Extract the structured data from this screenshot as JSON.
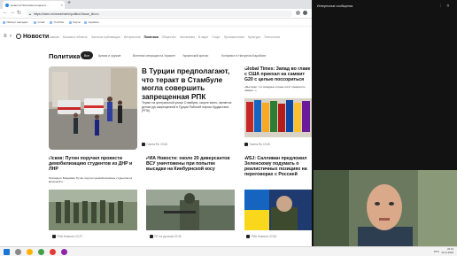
{
  "browser": {
    "tabs": [
      {
        "title": "Новости Политика сегодня в ..."
      },
      {
        "title": ""
      }
    ],
    "new_tab": "+",
    "address": "https://dzen.ru/news/rubric/politics?issue_tld=ru",
    "bookmarks": [
      "Импорт закладок",
      "Gmail",
      "YouTube",
      "Карты",
      "Сервисы"
    ]
  },
  "site": {
    "brand": "Новости",
    "nav": [
      "Главная",
      "Москва и область",
      "Частные публикации",
      "Интересное",
      "Политика",
      "Общество",
      "Экономика",
      "В мире",
      "Спорт",
      "Происшествия",
      "Культура",
      "Технологии"
    ],
    "active_nav": "Политика",
    "section_title": "Политика",
    "pills": [
      "Все",
      "Армия и оружие",
      "Военная операция на Украине",
      "Украинский кризис",
      "Конфликт в Нагорном Карабахе"
    ],
    "active_pill": "Все"
  },
  "cards": {
    "main": {
      "headline": "В Турции предполагают, что теракт в Стамбуле могла совершить запрещенная РПК",
      "lead": "Теракт на центральной улице Стамбула, скорее всего, является делом рук запрещенной в Турции Рабочей партии Курдистана (РПК).",
      "source": "Газета.Ru",
      "time": "19:46"
    },
    "global": {
      "headline": "Global Times: Запад во главе с США приехал на саммит G20 с целью поссориться",
      "lead": "«Выглядит, что западные страны хотят превратить саммит...»",
      "source": "Газета.Ru",
      "time": "19:45"
    },
    "pskov": {
      "headline": "Псков: Путин поручил провести демобилизацию студентов из ДНР и ЛНР",
      "lead": "Президент Владимир Путин поручил демобилизовать студентов из Донецкой и...",
      "source": "РИА Новости",
      "time": "22:27"
    },
    "ria": {
      "headline": "РИА Новости: около 20 диверсантов ВСУ уничтожены при попытке высадки на Кинбурнской косу",
      "source": "RT на русском",
      "time": "22:30"
    },
    "wsj": {
      "headline": "WSJ: Салливан предложил Зеленскому подумать о реалистичных позициях на переговорах с Россией",
      "source": "РИА Новости",
      "time": "22:53"
    }
  },
  "side_panel": {
    "title": "Интересные сообщения",
    "menu": "⋮",
    "close": "✕"
  },
  "taskbar": {
    "lang": "РУС",
    "time": "22:31",
    "date": "13.11.2022"
  },
  "colors": {
    "accent": "#222222",
    "panel_bg": "#121212",
    "link_blue": "#1e88e5"
  }
}
